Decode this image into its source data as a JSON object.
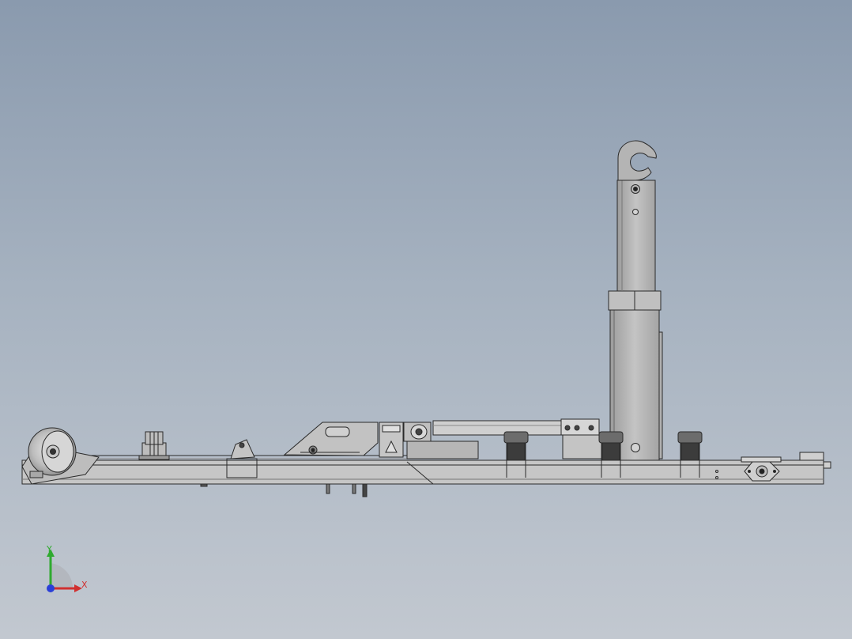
{
  "viewport": {
    "background_top": "#8a9aae",
    "background_bottom": "#c2c8d0"
  },
  "model": {
    "view": "side elevation",
    "body_color": "#c8c8c8",
    "edge_color": "#2a2a2a"
  },
  "triad": {
    "y_label": "Y",
    "x_label": "X",
    "y_color": "#2faa2f",
    "x_color": "#d03030",
    "z_color": "#2a3fd8"
  }
}
